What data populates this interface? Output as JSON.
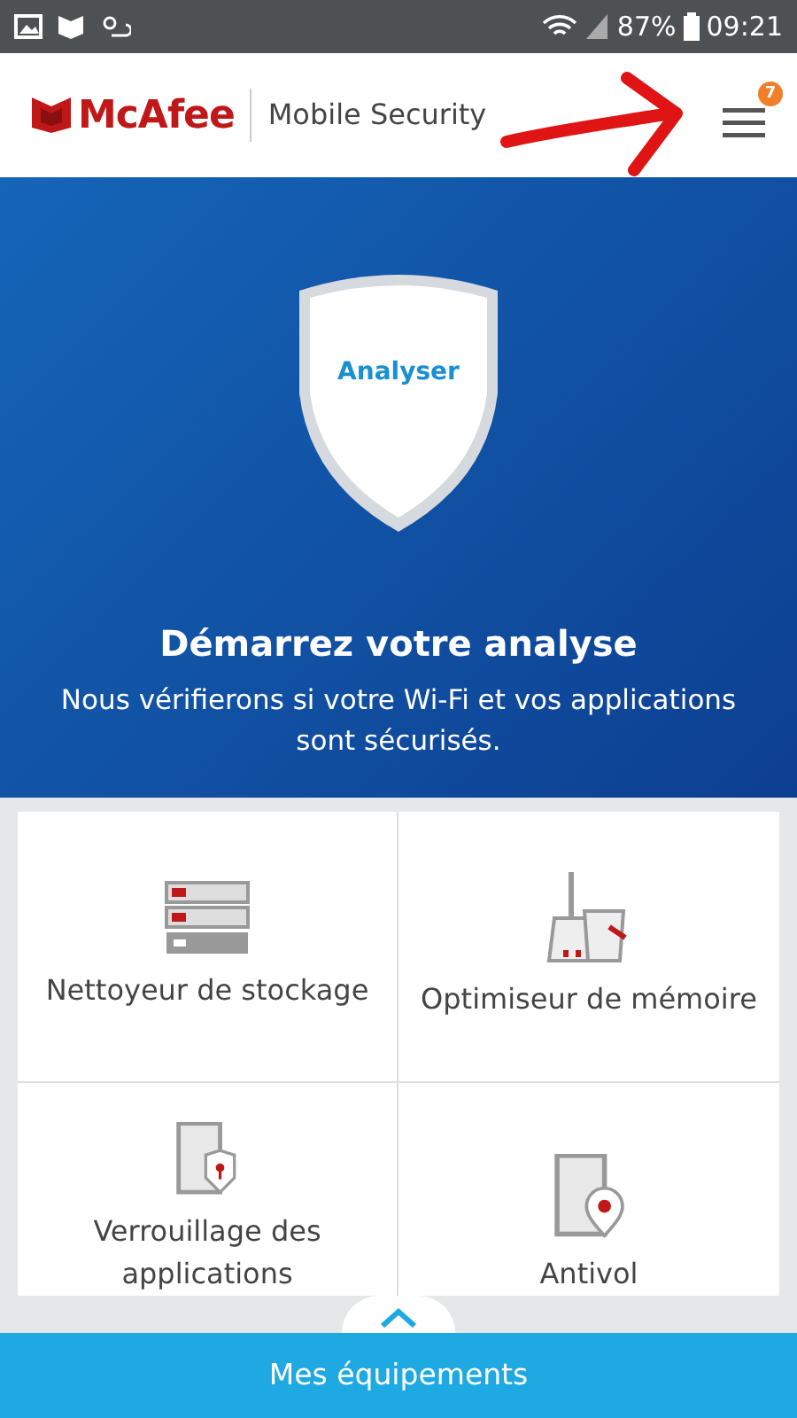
{
  "status_bar": {
    "battery": "87%",
    "time": "09:21"
  },
  "header": {
    "brand": "McAfee",
    "product": "Mobile Security",
    "menu_badge": "7"
  },
  "hero": {
    "shield_label": "Analyser",
    "title": "Démarrez votre analyse",
    "subtitle": "Nous vérifierons si votre Wi-Fi et vos applications sont sécurisés."
  },
  "tiles": [
    {
      "kind": "storage",
      "label": "Nettoyeur de stockage"
    },
    {
      "kind": "memory",
      "label": "Optimiseur de mémoire"
    },
    {
      "kind": "applock",
      "label": "Verrouillage des applications"
    },
    {
      "kind": "antitheft",
      "label": "Antivol"
    }
  ],
  "bottom_bar": {
    "label": "Mes équipements"
  }
}
